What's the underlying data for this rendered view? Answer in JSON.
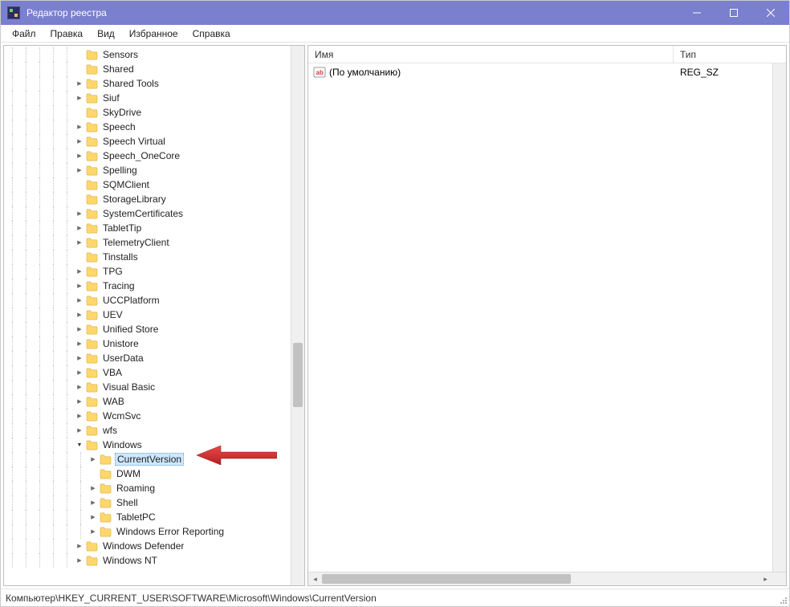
{
  "window": {
    "title": "Редактор реестра"
  },
  "menu": {
    "file": "Файл",
    "edit": "Правка",
    "view": "Вид",
    "favorites": "Избранное",
    "help": "Справка"
  },
  "tree": {
    "items": [
      {
        "level": 5,
        "expander": "",
        "label": "Sensors"
      },
      {
        "level": 5,
        "expander": "",
        "label": "Shared"
      },
      {
        "level": 5,
        "expander": ">",
        "label": "Shared Tools"
      },
      {
        "level": 5,
        "expander": ">",
        "label": "Siuf"
      },
      {
        "level": 5,
        "expander": "",
        "label": "SkyDrive"
      },
      {
        "level": 5,
        "expander": ">",
        "label": "Speech"
      },
      {
        "level": 5,
        "expander": ">",
        "label": "Speech Virtual"
      },
      {
        "level": 5,
        "expander": ">",
        "label": "Speech_OneCore"
      },
      {
        "level": 5,
        "expander": ">",
        "label": "Spelling"
      },
      {
        "level": 5,
        "expander": "",
        "label": "SQMClient"
      },
      {
        "level": 5,
        "expander": "",
        "label": "StorageLibrary"
      },
      {
        "level": 5,
        "expander": ">",
        "label": "SystemCertificates"
      },
      {
        "level": 5,
        "expander": ">",
        "label": "TabletTip"
      },
      {
        "level": 5,
        "expander": ">",
        "label": "TelemetryClient"
      },
      {
        "level": 5,
        "expander": "",
        "label": "Tinstalls"
      },
      {
        "level": 5,
        "expander": ">",
        "label": "TPG"
      },
      {
        "level": 5,
        "expander": ">",
        "label": "Tracing"
      },
      {
        "level": 5,
        "expander": ">",
        "label": "UCCPlatform"
      },
      {
        "level": 5,
        "expander": ">",
        "label": "UEV"
      },
      {
        "level": 5,
        "expander": ">",
        "label": "Unified Store"
      },
      {
        "level": 5,
        "expander": ">",
        "label": "Unistore"
      },
      {
        "level": 5,
        "expander": ">",
        "label": "UserData"
      },
      {
        "level": 5,
        "expander": ">",
        "label": "VBA"
      },
      {
        "level": 5,
        "expander": ">",
        "label": "Visual Basic"
      },
      {
        "level": 5,
        "expander": ">",
        "label": "WAB"
      },
      {
        "level": 5,
        "expander": ">",
        "label": "WcmSvc"
      },
      {
        "level": 5,
        "expander": ">",
        "label": "wfs"
      },
      {
        "level": 5,
        "expander": "v",
        "label": "Windows"
      },
      {
        "level": 6,
        "expander": ">",
        "label": "CurrentVersion",
        "selected": true
      },
      {
        "level": 6,
        "expander": "",
        "label": "DWM"
      },
      {
        "level": 6,
        "expander": ">",
        "label": "Roaming"
      },
      {
        "level": 6,
        "expander": ">",
        "label": "Shell"
      },
      {
        "level": 6,
        "expander": ">",
        "label": "TabletPC"
      },
      {
        "level": 6,
        "expander": ">",
        "label": "Windows Error Reporting"
      },
      {
        "level": 5,
        "expander": ">",
        "label": "Windows Defender"
      },
      {
        "level": 5,
        "expander": ">",
        "label": "Windows NT"
      }
    ]
  },
  "list": {
    "header_name": "Имя",
    "header_type": "Тип",
    "rows": [
      {
        "name": "(По умолчанию)",
        "type": "REG_SZ"
      }
    ]
  },
  "status": {
    "path": "Компьютер\\HKEY_CURRENT_USER\\SOFTWARE\\Microsoft\\Windows\\CurrentVersion"
  }
}
